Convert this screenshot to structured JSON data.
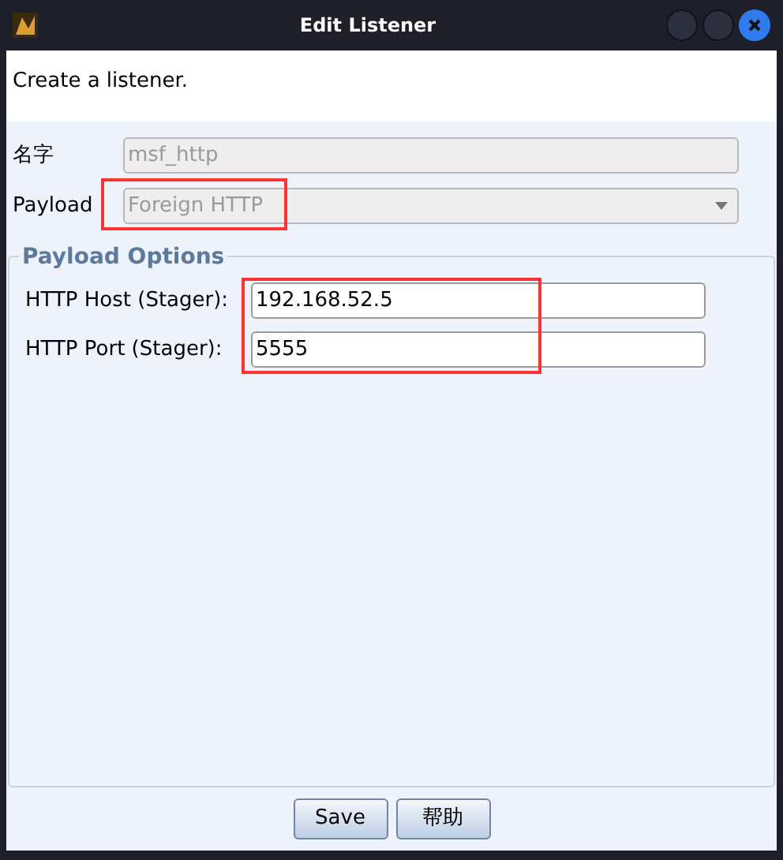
{
  "window": {
    "title": "Edit Listener"
  },
  "description": "Create a listener.",
  "name_field": {
    "label": "名字",
    "value": "msf_http",
    "disabled": true
  },
  "payload_field": {
    "label": "Payload",
    "value": "Foreign HTTP",
    "disabled": true,
    "highlighted": true
  },
  "payload_options": {
    "title": "Payload Options",
    "highlighted": true,
    "fields": [
      {
        "label": "HTTP Host (Stager):",
        "value": "192.168.52.5"
      },
      {
        "label": "HTTP Port (Stager):",
        "value": "5555"
      }
    ]
  },
  "buttons": [
    "Save",
    "帮助"
  ]
}
